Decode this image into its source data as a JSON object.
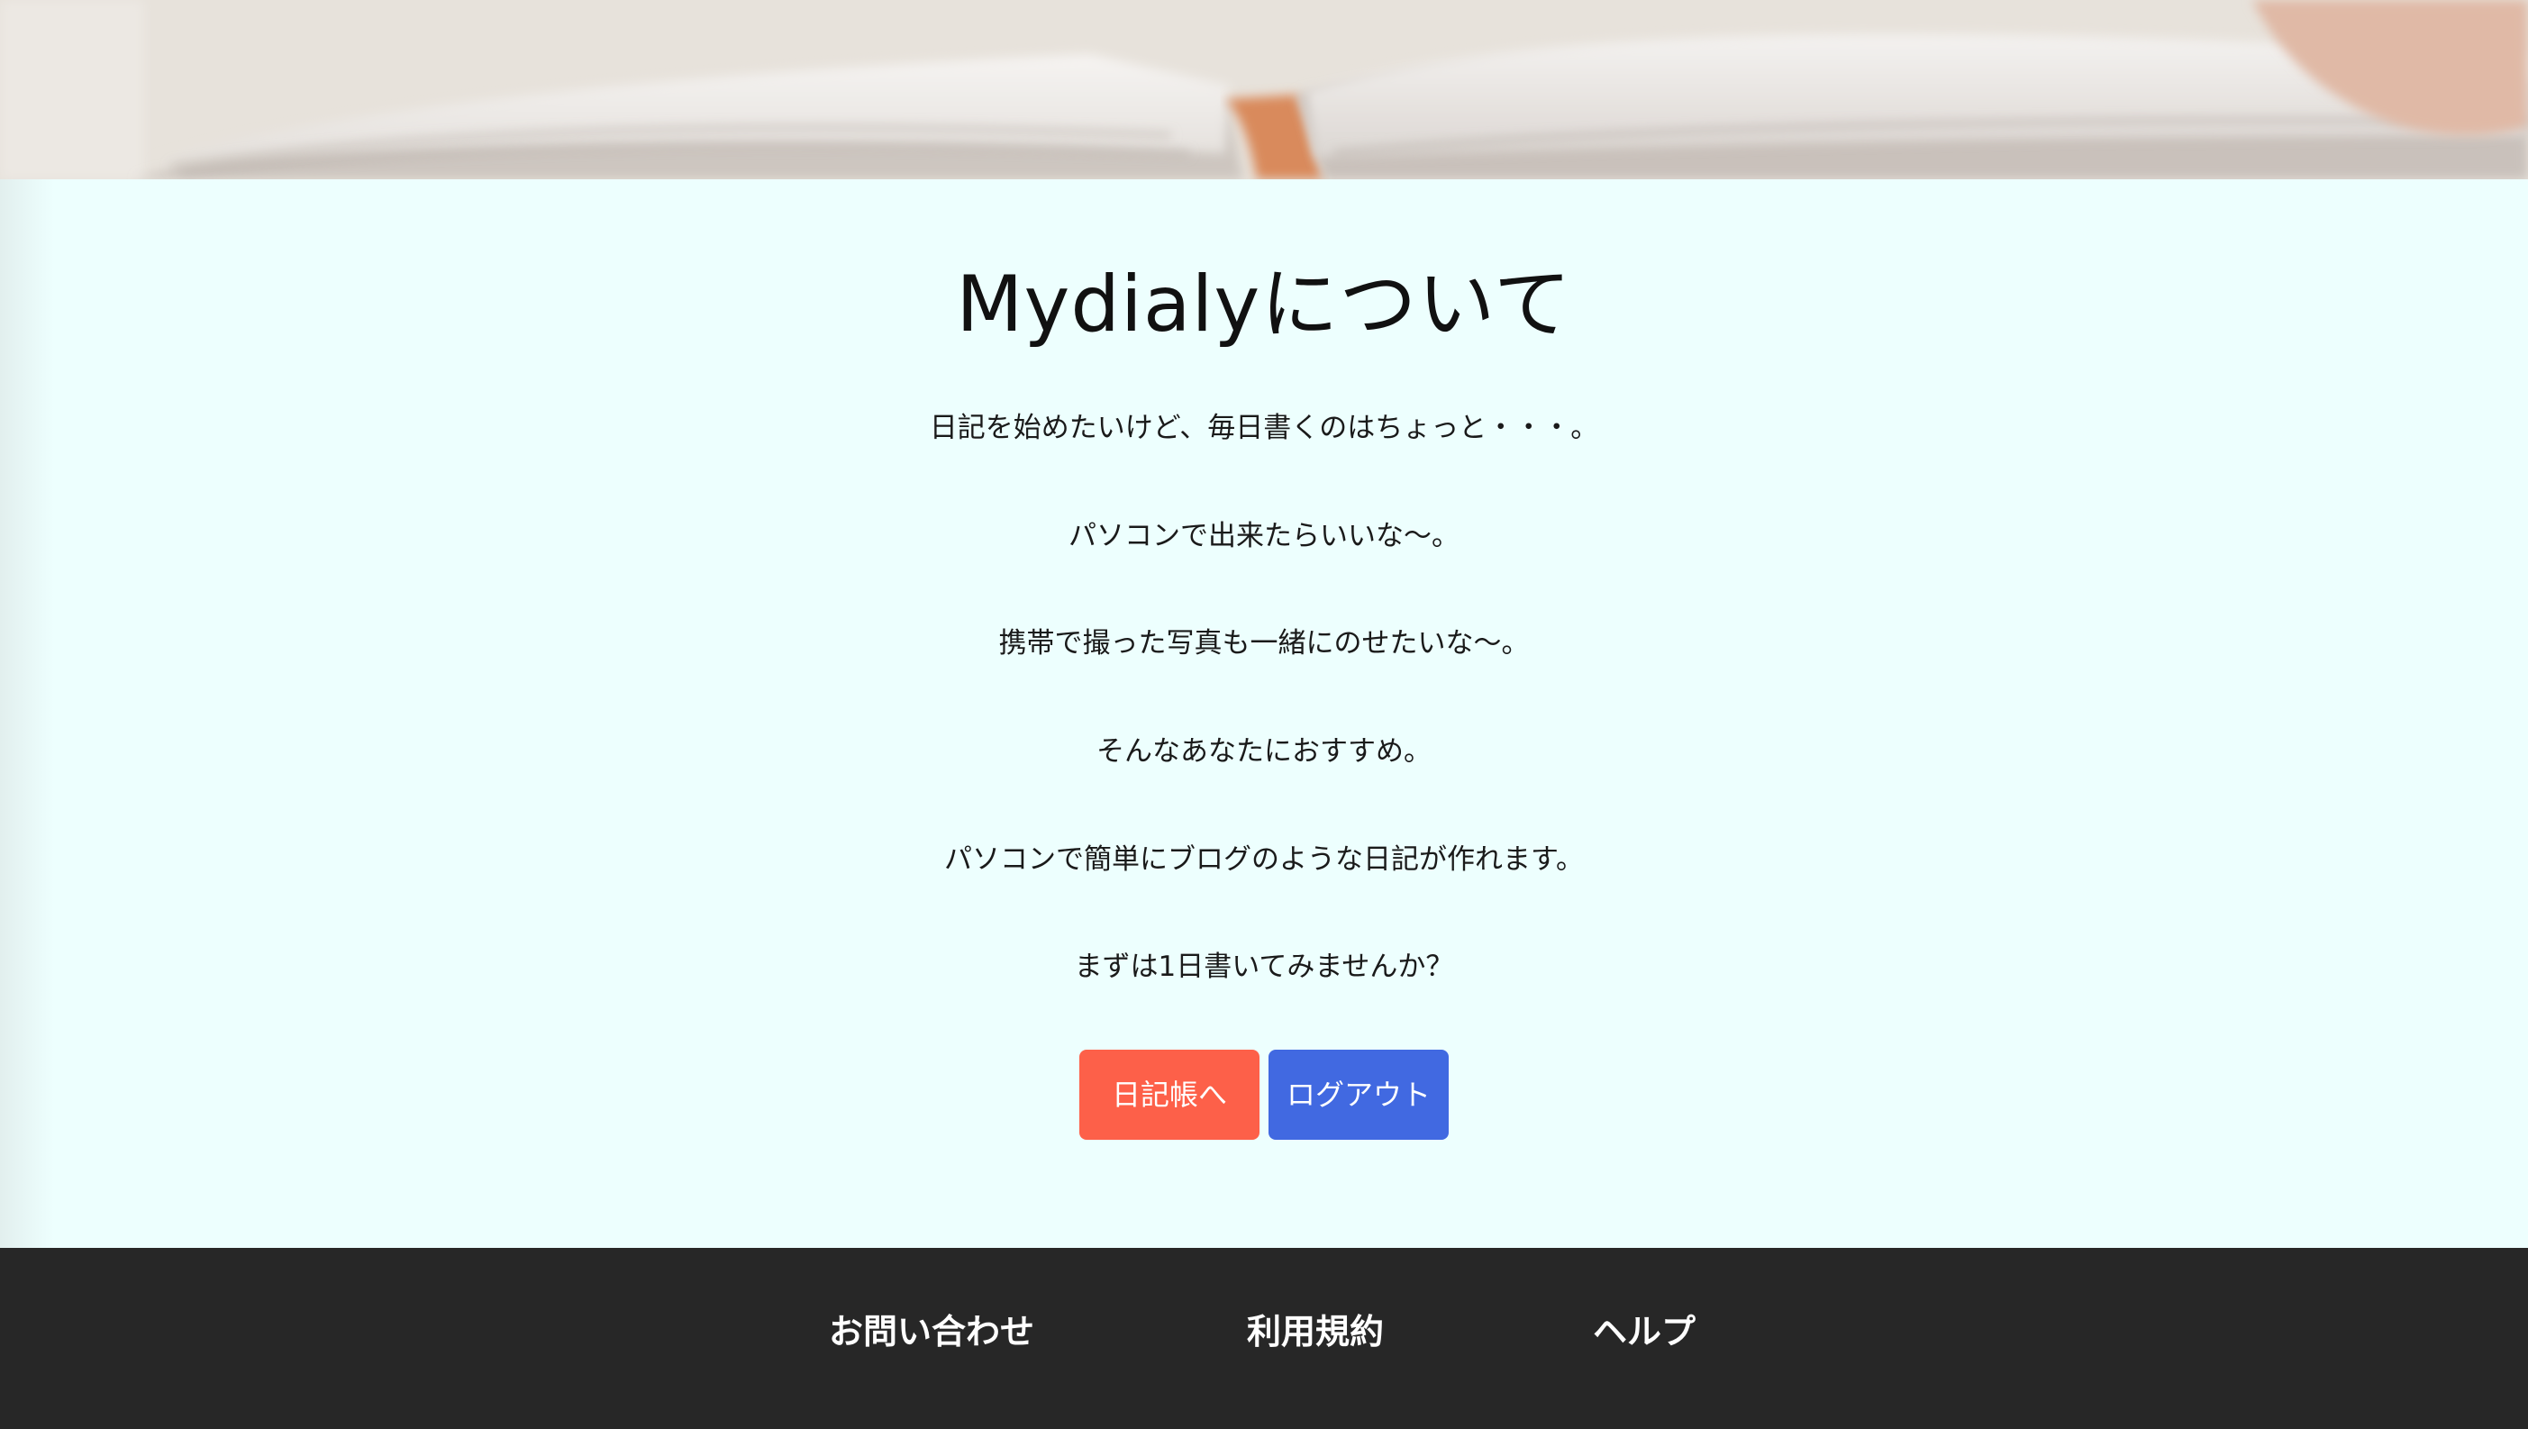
{
  "hero": {
    "image": "open-book-photo"
  },
  "about": {
    "title": "Mydialyについて",
    "paragraphs": [
      "日記を始めたいけど、毎日書くのはちょっと・・・。",
      "パソコンで出来たらいいな〜。",
      "携帯で撮った写真も一緒にのせたいな〜。",
      "そんなあなたにおすすめ。",
      "パソコンで簡単にブログのような日記が作れます。",
      "まずは1日書いてみませんか？"
    ],
    "buttons": {
      "diary_label": "日記帳へ",
      "logout_label": "ログアウト"
    }
  },
  "footer": {
    "links": [
      "お問い合わせ",
      "利用規約",
      "ヘルプ"
    ]
  },
  "colors": {
    "content_bg": "#edfffe",
    "diary_button": "#fd6049",
    "logout_button": "#4169e1",
    "footer_bg": "#272727"
  }
}
